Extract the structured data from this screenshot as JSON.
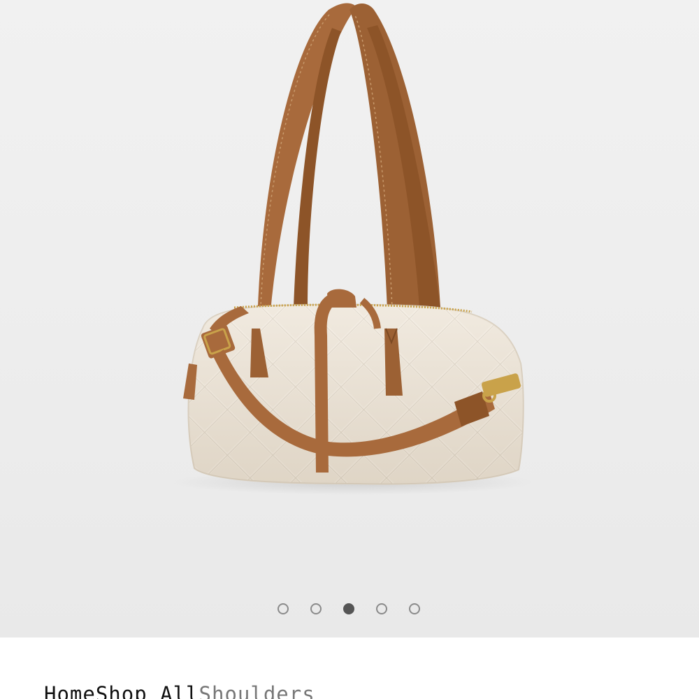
{
  "gallery": {
    "image_alt": "Quilted shoulder bag with cognac leather straps",
    "slide_count": 5,
    "active_slide": 3,
    "colors": {
      "bag_body": "#f0e8dc",
      "straps": "#a86a3c",
      "hardware": "#c9a24a",
      "dot_inactive": "#8a8a8a",
      "dot_active": "#555555"
    }
  },
  "breadcrumb": {
    "items": [
      {
        "label": "Home"
      },
      {
        "label": "Shop All"
      },
      {
        "label": "Shoulders"
      }
    ]
  }
}
